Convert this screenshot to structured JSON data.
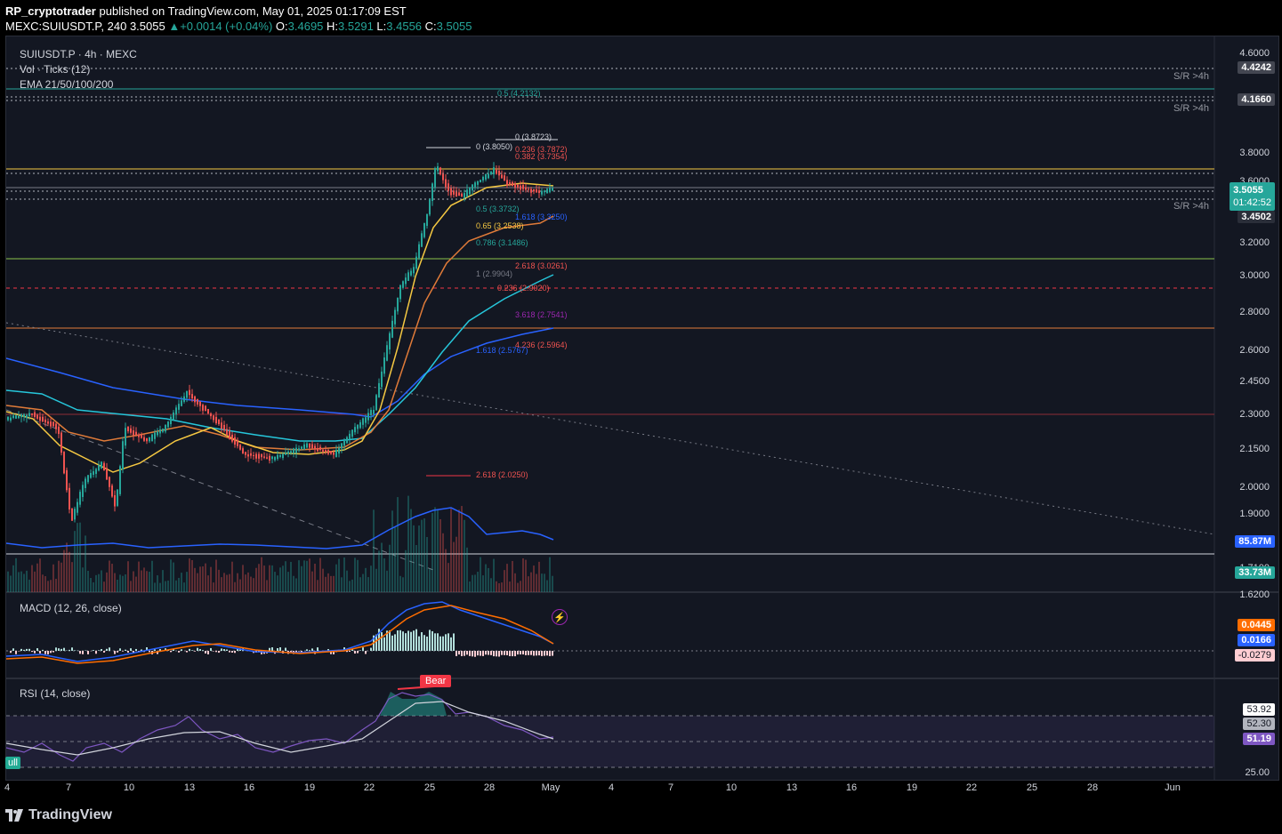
{
  "header": {
    "author": "RP_cryptotrader",
    "published": "published on TradingView.com, May 01, 2025 01:17:09 EST",
    "symbol_line": "MEXC:SUIUSDT.P, 240",
    "last": "3.5055",
    "change": "+0.0014 (+0.04%)",
    "o_label": "O:",
    "o": "3.4695",
    "h_label": "H:",
    "h": "3.5291",
    "l_label": "L:",
    "l": "3.4556",
    "c_label": "C:",
    "c": "3.5055"
  },
  "legends": {
    "main": "SUIUSDT.P · 4h · MEXC",
    "vol": "Vol · Ticks (12)",
    "ema": "EMA 21/50/100/200",
    "macd": "MACD (12, 26, close)",
    "rsi": "RSI (14, close)"
  },
  "price_axis": [
    "4.6000",
    "3.8000",
    "3.6000",
    "3.2000",
    "3.0000",
    "2.8000",
    "2.6000",
    "2.4500",
    "2.3000",
    "2.1500",
    "2.0000",
    "1.9000",
    "1.7100",
    "1.6200"
  ],
  "price_tags": {
    "t1": "4.4242",
    "t2": "4.1660",
    "t3_price": "3.5055",
    "t3_time": "01:42:52",
    "t4": "3.4502",
    "vol_a": "85.87M",
    "vol_b": "33.73M",
    "macd_a": "0.0445",
    "macd_b": "0.0166",
    "macd_c": "-0.0279",
    "rsi_a": "53.92",
    "rsi_b": "52.30",
    "rsi_c": "51.19",
    "rsi_axis": "25.00"
  },
  "sr_labels": [
    "S/R >4h",
    "S/R >4h",
    "S/R >4h"
  ],
  "fib_labels": [
    "0.5 (4.2132)",
    "0 (3.8723)",
    "0 (3.8050)",
    "0.236 (3.7872)",
    "0.382 (3.7354)",
    "0.5 (3.3732)",
    "1.618 (3.3250)",
    "0.65 (3.2538)",
    "0.786 (3.1486)",
    "2.618 (3.0261)",
    "1 (2.9904)",
    "0.236 (2.9020)",
    "3.618 (2.7541)",
    "4.236 (2.5964)",
    "1.618 (2.5767)",
    "2.618 (2.0250)"
  ],
  "x_axis": [
    "4",
    "7",
    "10",
    "13",
    "16",
    "19",
    "22",
    "25",
    "28",
    "May",
    "4",
    "7",
    "10",
    "13",
    "16",
    "19",
    "22",
    "25",
    "28",
    "Jun"
  ],
  "signals": {
    "bear": "Bear",
    "bull": "ull"
  },
  "footer": {
    "brand": "TradingView"
  },
  "colors": {
    "background": "#131722",
    "up": "#26a69a",
    "down": "#ef5350",
    "ema21": "#f5c842",
    "ema50": "#e07b39",
    "ema100": "#26c6da",
    "ema200": "#2962ff",
    "macd": "#2962ff",
    "signal": "#ff6d00",
    "rsi": "#7e57c2"
  }
}
